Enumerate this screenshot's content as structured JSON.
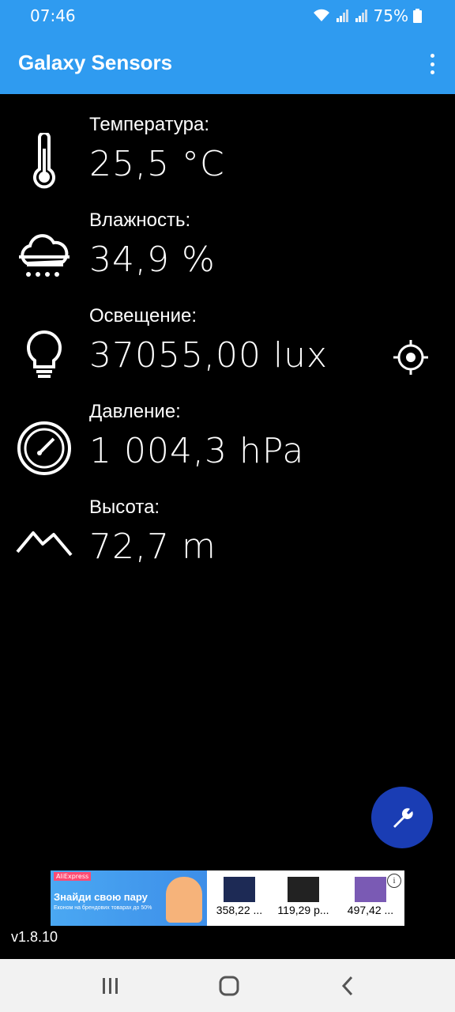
{
  "status_bar": {
    "time": "07:46",
    "battery": "75%",
    "icons": [
      "wifi-icon",
      "signal-icon",
      "signal-icon",
      "battery-icon"
    ]
  },
  "app_bar": {
    "title": "Galaxy Sensors",
    "menu_icon": "overflow-menu-icon"
  },
  "sensors": [
    {
      "label": "Температура:",
      "value": "25,5 °C",
      "icon": "thermometer-icon"
    },
    {
      "label": "Влажность:",
      "value": "34,9 %",
      "icon": "rain-cloud-icon"
    },
    {
      "label": "Освещение:",
      "value": "37055,00 lux",
      "icon": "lightbulb-icon",
      "action_icon": "target-icon"
    },
    {
      "label": "Давление:",
      "value": "1 004,3 hPa",
      "icon": "gauge-icon"
    },
    {
      "label": "Высота:",
      "value": "72,7 m",
      "icon": "mountain-icon"
    }
  ],
  "fab": {
    "icon": "wrench-icon"
  },
  "ad": {
    "brand": "AliExpress",
    "headline": "Знайди свою пару",
    "subtitle": "Економ на брендових товарах до 50%",
    "products": [
      {
        "price": "358,22 ..."
      },
      {
        "price": "119,29 р..."
      },
      {
        "price": "497,42 ..."
      }
    ],
    "info_icon": "info-icon"
  },
  "version": "v1.8.10",
  "nav_bar": {
    "items": [
      "recents-icon",
      "home-icon",
      "back-icon"
    ]
  },
  "colors": {
    "primary": "#2f9bf0",
    "fab": "#1a3db4",
    "background": "#000000"
  }
}
